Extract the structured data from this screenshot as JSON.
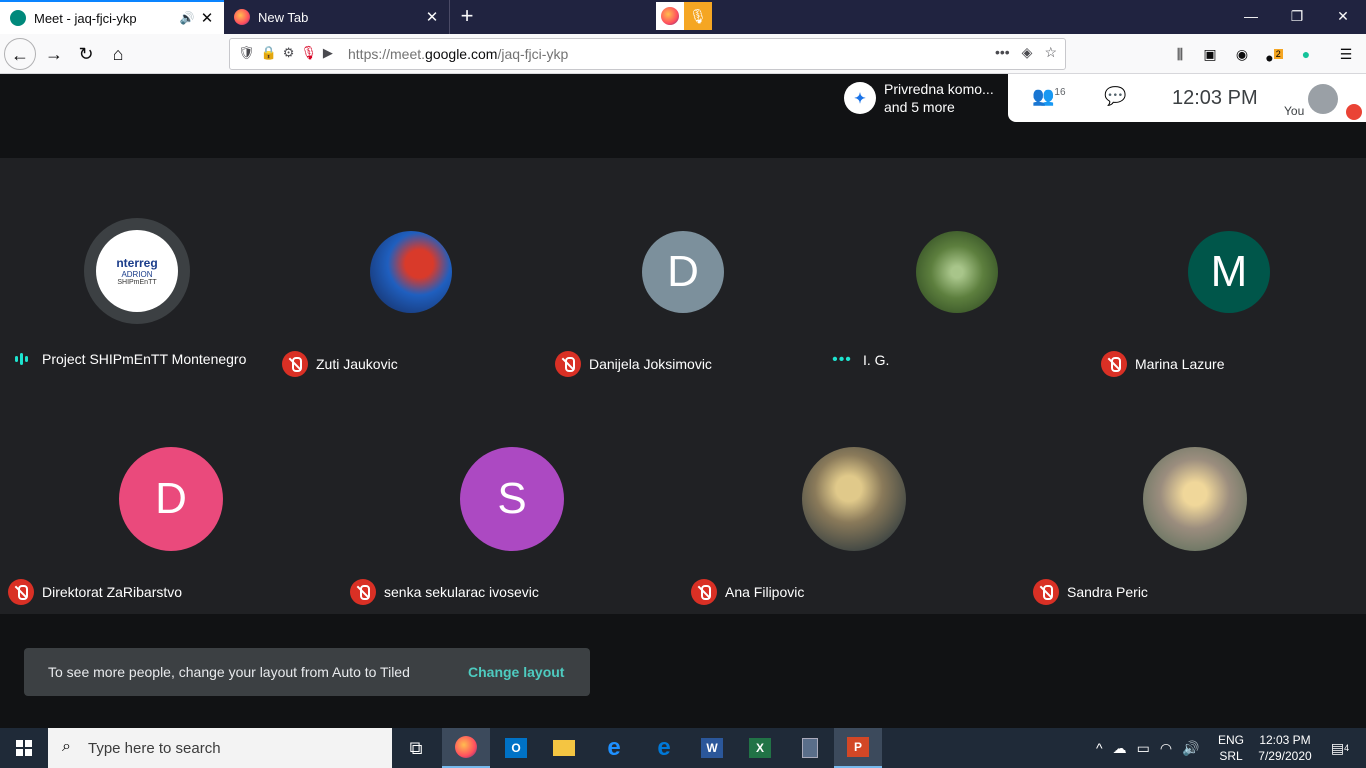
{
  "browser": {
    "tabs": [
      {
        "title": "Meet - jaq-fjci-ykp"
      },
      {
        "title": "New Tab"
      }
    ],
    "new_tab": "+",
    "url_prefix": "https://meet.",
    "url_domain": "google.com",
    "url_path": "/jaq-fjci-ykp",
    "window_controls": {
      "minimize": "—",
      "restore": "❐",
      "close": "✕"
    },
    "extension_badge": "2"
  },
  "meet": {
    "presenter": {
      "line1": "Privredna komo...",
      "line2": "and 5 more"
    },
    "participant_count": "16",
    "clock": "12:03  PM",
    "you_label": "You",
    "participants": [
      {
        "name": "Project SHIPmEnTT Montenegro",
        "status": "speaking",
        "avatar_type": "logo",
        "logo_text": "nterreg",
        "logo_sub": "ADRION",
        "logo_name": "SHIPmEnTT"
      },
      {
        "name": "Zuti Jaukovic",
        "status": "muted",
        "avatar_type": "photo",
        "color": "#1f5fbf"
      },
      {
        "name": "Danijela Joksimovic",
        "status": "muted",
        "avatar_type": "letter",
        "letter": "D",
        "color": "#7c909c"
      },
      {
        "name": "I. G.",
        "status": "idle",
        "avatar_type": "photo",
        "color": "#6f8f4e"
      },
      {
        "name": "Marina Lazure",
        "status": "muted",
        "avatar_type": "letter",
        "letter": "M",
        "color": "#00564a"
      },
      {
        "name": "Direktorat ZaRibarstvo",
        "status": "muted",
        "avatar_type": "letter",
        "letter": "D",
        "color": "#ea4a7c"
      },
      {
        "name": "senka sekularac ivosevic",
        "status": "muted",
        "avatar_type": "letter",
        "letter": "S",
        "color": "#ac49c2"
      },
      {
        "name": "Ana Filipovic",
        "status": "muted",
        "avatar_type": "photo",
        "color": "#8a7a5a"
      },
      {
        "name": "Sandra Peric",
        "status": "muted",
        "avatar_type": "photo",
        "color": "#9b8d7e"
      }
    ],
    "toast": {
      "text": "To see more people, change your layout from Auto to Tiled",
      "action": "Change layout"
    }
  },
  "taskbar": {
    "search_placeholder": "Type here to search",
    "lang_top": "ENG",
    "lang_bottom": "SRL",
    "time": "12:03 PM",
    "date": "7/29/2020",
    "notifications": "4"
  }
}
